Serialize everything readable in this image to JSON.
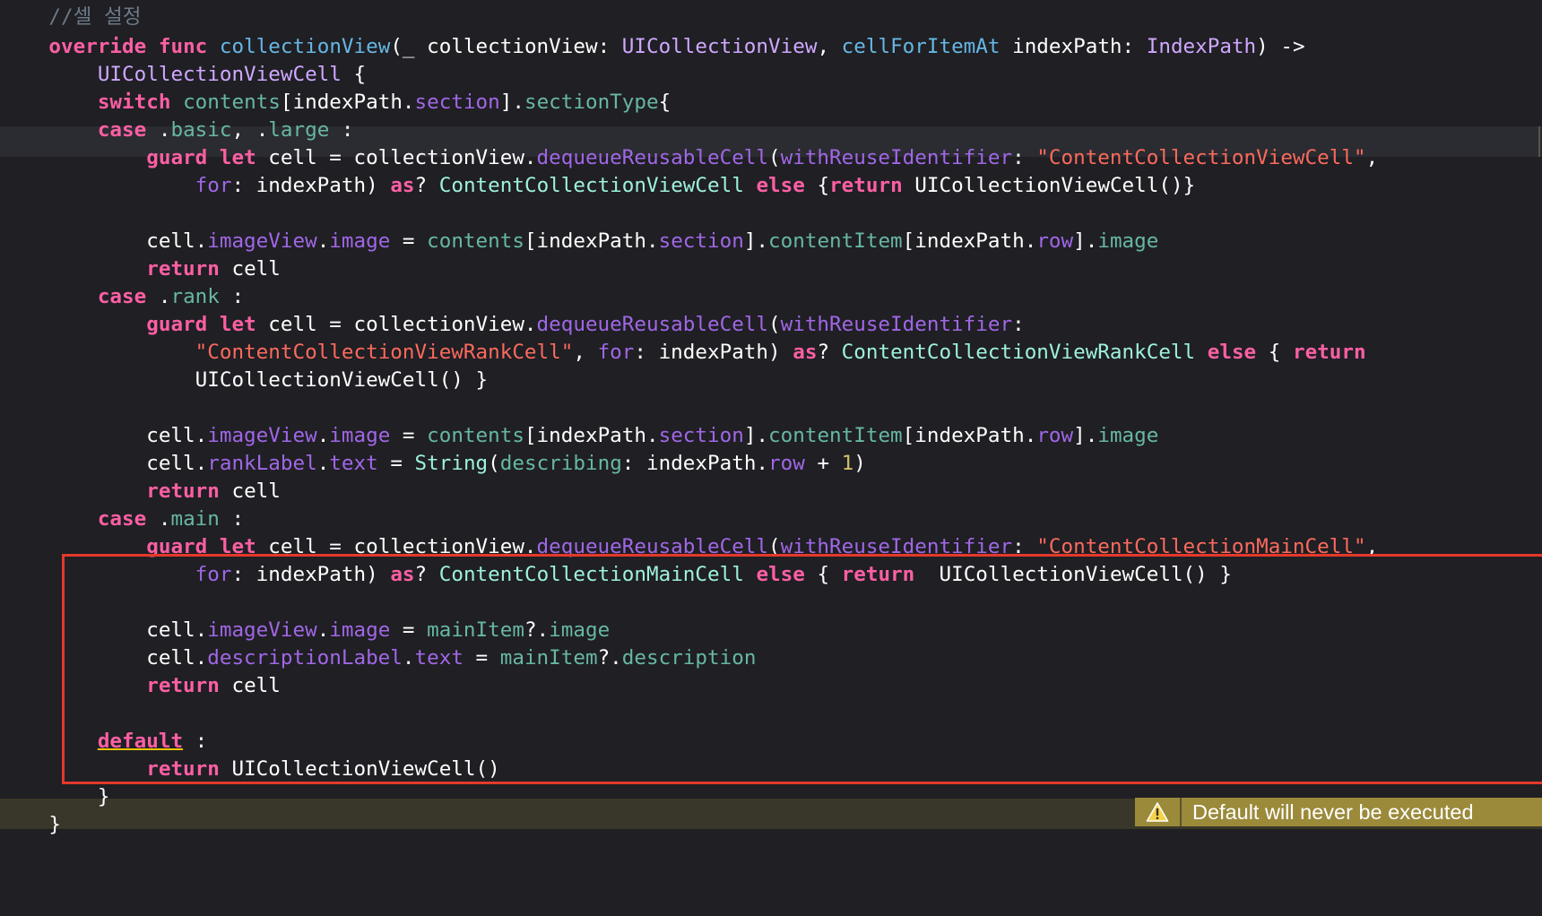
{
  "editor": {
    "lines": [
      [
        {
          "t": "    ",
          "c": "plain"
        },
        {
          "t": "//셀 설정",
          "c": "com"
        }
      ],
      [
        {
          "t": "    ",
          "c": "plain"
        },
        {
          "t": "override",
          "c": "kw"
        },
        {
          "t": " ",
          "c": "plain"
        },
        {
          "t": "func",
          "c": "kw"
        },
        {
          "t": " ",
          "c": "plain"
        },
        {
          "t": "collectionView",
          "c": "fn"
        },
        {
          "t": "(_ collectionView: ",
          "c": "plain"
        },
        {
          "t": "UICollectionView",
          "c": "type"
        },
        {
          "t": ", ",
          "c": "plain"
        },
        {
          "t": "cellForItemAt",
          "c": "fn"
        },
        {
          "t": " indexPath: ",
          "c": "plain"
        },
        {
          "t": "IndexPath",
          "c": "type"
        },
        {
          "t": ") ->",
          "c": "plain"
        }
      ],
      [
        {
          "t": "        ",
          "c": "plain"
        },
        {
          "t": "UICollectionViewCell",
          "c": "type"
        },
        {
          "t": " {",
          "c": "plain"
        }
      ],
      [
        {
          "t": "        ",
          "c": "plain"
        },
        {
          "t": "switch",
          "c": "kw"
        },
        {
          "t": " ",
          "c": "plain"
        },
        {
          "t": "contents",
          "c": "prop"
        },
        {
          "t": "[indexPath.",
          "c": "plain"
        },
        {
          "t": "section",
          "c": "mem"
        },
        {
          "t": "].",
          "c": "plain"
        },
        {
          "t": "sectionType",
          "c": "prop"
        },
        {
          "t": "{",
          "c": "plain"
        }
      ],
      [
        {
          "t": "        ",
          "c": "plain"
        },
        {
          "t": "case",
          "c": "kw"
        },
        {
          "t": " .",
          "c": "plain"
        },
        {
          "t": "basic",
          "c": "prop"
        },
        {
          "t": ", .",
          "c": "plain"
        },
        {
          "t": "large",
          "c": "prop"
        },
        {
          "t": " :",
          "c": "plain"
        }
      ],
      [
        {
          "t": "            ",
          "c": "plain"
        },
        {
          "t": "guard",
          "c": "kw"
        },
        {
          "t": " ",
          "c": "plain"
        },
        {
          "t": "let",
          "c": "kw"
        },
        {
          "t": " cell = collectionView.",
          "c": "plain"
        },
        {
          "t": "dequeueReusableCell",
          "c": "mem"
        },
        {
          "t": "(",
          "c": "plain"
        },
        {
          "t": "withReuseIdentifier",
          "c": "mem"
        },
        {
          "t": ": ",
          "c": "plain"
        },
        {
          "t": "\"ContentCollectionViewCell\"",
          "c": "str"
        },
        {
          "t": ",",
          "c": "plain"
        }
      ],
      [
        {
          "t": "                ",
          "c": "plain"
        },
        {
          "t": "for",
          "c": "mem"
        },
        {
          "t": ": indexPath) ",
          "c": "plain"
        },
        {
          "t": "as",
          "c": "kw"
        },
        {
          "t": "? ",
          "c": "plain"
        },
        {
          "t": "ContentCollectionViewCell",
          "c": "cls"
        },
        {
          "t": " ",
          "c": "plain"
        },
        {
          "t": "else",
          "c": "kw"
        },
        {
          "t": " {",
          "c": "plain"
        },
        {
          "t": "return",
          "c": "kw"
        },
        {
          "t": " UICollectionViewCell()}",
          "c": "plain"
        }
      ],
      [
        {
          "t": "",
          "c": "plain"
        }
      ],
      [
        {
          "t": "            cell.",
          "c": "plain"
        },
        {
          "t": "imageView",
          "c": "mem"
        },
        {
          "t": ".",
          "c": "plain"
        },
        {
          "t": "image",
          "c": "mem"
        },
        {
          "t": " = ",
          "c": "plain"
        },
        {
          "t": "contents",
          "c": "prop"
        },
        {
          "t": "[indexPath.",
          "c": "plain"
        },
        {
          "t": "section",
          "c": "mem"
        },
        {
          "t": "].",
          "c": "plain"
        },
        {
          "t": "contentItem",
          "c": "prop"
        },
        {
          "t": "[indexPath.",
          "c": "plain"
        },
        {
          "t": "row",
          "c": "mem"
        },
        {
          "t": "].",
          "c": "plain"
        },
        {
          "t": "image",
          "c": "prop"
        }
      ],
      [
        {
          "t": "            ",
          "c": "plain"
        },
        {
          "t": "return",
          "c": "kw"
        },
        {
          "t": " cell",
          "c": "plain"
        }
      ],
      [
        {
          "t": "        ",
          "c": "plain"
        },
        {
          "t": "case",
          "c": "kw"
        },
        {
          "t": " .",
          "c": "plain"
        },
        {
          "t": "rank",
          "c": "prop"
        },
        {
          "t": " :",
          "c": "plain"
        }
      ],
      [
        {
          "t": "            ",
          "c": "plain"
        },
        {
          "t": "guard",
          "c": "kw"
        },
        {
          "t": " ",
          "c": "plain"
        },
        {
          "t": "let",
          "c": "kw"
        },
        {
          "t": " cell = collectionView.",
          "c": "plain"
        },
        {
          "t": "dequeueReusableCell",
          "c": "mem"
        },
        {
          "t": "(",
          "c": "plain"
        },
        {
          "t": "withReuseIdentifier",
          "c": "mem"
        },
        {
          "t": ":",
          "c": "plain"
        }
      ],
      [
        {
          "t": "                ",
          "c": "plain"
        },
        {
          "t": "\"ContentCollectionViewRankCell\"",
          "c": "str"
        },
        {
          "t": ", ",
          "c": "plain"
        },
        {
          "t": "for",
          "c": "mem"
        },
        {
          "t": ": indexPath) ",
          "c": "plain"
        },
        {
          "t": "as",
          "c": "kw"
        },
        {
          "t": "? ",
          "c": "plain"
        },
        {
          "t": "ContentCollectionViewRankCell",
          "c": "cls"
        },
        {
          "t": " ",
          "c": "plain"
        },
        {
          "t": "else",
          "c": "kw"
        },
        {
          "t": " { ",
          "c": "plain"
        },
        {
          "t": "return",
          "c": "kw"
        }
      ],
      [
        {
          "t": "                UICollectionViewCell() }",
          "c": "plain"
        }
      ],
      [
        {
          "t": "",
          "c": "plain"
        }
      ],
      [
        {
          "t": "            cell.",
          "c": "plain"
        },
        {
          "t": "imageView",
          "c": "mem"
        },
        {
          "t": ".",
          "c": "plain"
        },
        {
          "t": "image",
          "c": "mem"
        },
        {
          "t": " = ",
          "c": "plain"
        },
        {
          "t": "contents",
          "c": "prop"
        },
        {
          "t": "[indexPath.",
          "c": "plain"
        },
        {
          "t": "section",
          "c": "mem"
        },
        {
          "t": "].",
          "c": "plain"
        },
        {
          "t": "contentItem",
          "c": "prop"
        },
        {
          "t": "[indexPath.",
          "c": "plain"
        },
        {
          "t": "row",
          "c": "mem"
        },
        {
          "t": "].",
          "c": "plain"
        },
        {
          "t": "image",
          "c": "prop"
        }
      ],
      [
        {
          "t": "            cell.",
          "c": "plain"
        },
        {
          "t": "rankLabel",
          "c": "mem"
        },
        {
          "t": ".",
          "c": "plain"
        },
        {
          "t": "text",
          "c": "mem"
        },
        {
          "t": " = ",
          "c": "plain"
        },
        {
          "t": "String",
          "c": "cls"
        },
        {
          "t": "(",
          "c": "plain"
        },
        {
          "t": "describing",
          "c": "prop"
        },
        {
          "t": ": indexPath.",
          "c": "plain"
        },
        {
          "t": "row",
          "c": "mem"
        },
        {
          "t": " + ",
          "c": "plain"
        },
        {
          "t": "1",
          "c": "num"
        },
        {
          "t": ")",
          "c": "plain"
        }
      ],
      [
        {
          "t": "            ",
          "c": "plain"
        },
        {
          "t": "return",
          "c": "kw"
        },
        {
          "t": " cell",
          "c": "plain"
        }
      ],
      [
        {
          "t": "        ",
          "c": "plain"
        },
        {
          "t": "case",
          "c": "kw"
        },
        {
          "t": " .",
          "c": "plain"
        },
        {
          "t": "main",
          "c": "prop"
        },
        {
          "t": " :",
          "c": "plain"
        }
      ],
      [
        {
          "t": "            ",
          "c": "plain"
        },
        {
          "t": "guard",
          "c": "kw"
        },
        {
          "t": " ",
          "c": "plain"
        },
        {
          "t": "let",
          "c": "kw"
        },
        {
          "t": " cell = collectionView.",
          "c": "plain"
        },
        {
          "t": "dequeueReusableCell",
          "c": "mem"
        },
        {
          "t": "(",
          "c": "plain"
        },
        {
          "t": "withReuseIdentifier",
          "c": "mem"
        },
        {
          "t": ": ",
          "c": "plain"
        },
        {
          "t": "\"ContentCollectionMainCell\"",
          "c": "str"
        },
        {
          "t": ",",
          "c": "plain"
        }
      ],
      [
        {
          "t": "                ",
          "c": "plain"
        },
        {
          "t": "for",
          "c": "mem"
        },
        {
          "t": ": indexPath) ",
          "c": "plain"
        },
        {
          "t": "as",
          "c": "kw"
        },
        {
          "t": "? ",
          "c": "plain"
        },
        {
          "t": "ContentCollectionMainCell",
          "c": "cls"
        },
        {
          "t": " ",
          "c": "plain"
        },
        {
          "t": "else",
          "c": "kw"
        },
        {
          "t": " { ",
          "c": "plain"
        },
        {
          "t": "return",
          "c": "kw"
        },
        {
          "t": "  UICollectionViewCell() }",
          "c": "plain"
        }
      ],
      [
        {
          "t": "",
          "c": "plain"
        }
      ],
      [
        {
          "t": "            cell.",
          "c": "plain"
        },
        {
          "t": "imageView",
          "c": "mem"
        },
        {
          "t": ".",
          "c": "plain"
        },
        {
          "t": "image",
          "c": "mem"
        },
        {
          "t": " = ",
          "c": "plain"
        },
        {
          "t": "mainItem",
          "c": "prop"
        },
        {
          "t": "?.",
          "c": "plain"
        },
        {
          "t": "image",
          "c": "prop"
        }
      ],
      [
        {
          "t": "            cell.",
          "c": "plain"
        },
        {
          "t": "descriptionLabel",
          "c": "mem"
        },
        {
          "t": ".",
          "c": "plain"
        },
        {
          "t": "text",
          "c": "mem"
        },
        {
          "t": " = ",
          "c": "plain"
        },
        {
          "t": "mainItem",
          "c": "prop"
        },
        {
          "t": "?.",
          "c": "plain"
        },
        {
          "t": "description",
          "c": "prop"
        }
      ],
      [
        {
          "t": "            ",
          "c": "plain"
        },
        {
          "t": "return",
          "c": "kw"
        },
        {
          "t": " cell",
          "c": "plain"
        }
      ],
      [
        {
          "t": "",
          "c": "plain"
        }
      ],
      [
        {
          "t": "        ",
          "c": "plain"
        },
        {
          "t": "default",
          "c": "kw",
          "u": true
        },
        {
          "t": " :",
          "c": "plain"
        }
      ],
      [
        {
          "t": "            ",
          "c": "plain"
        },
        {
          "t": "return",
          "c": "kw"
        },
        {
          "t": " UICollectionViewCell()",
          "c": "plain"
        }
      ],
      [
        {
          "t": "        }",
          "c": "plain"
        }
      ],
      [
        {
          "t": "    }",
          "c": "plain"
        }
      ]
    ]
  },
  "warning": {
    "icon": "warning-triangle-icon",
    "message": "Default will never be executed"
  },
  "colors": {
    "background": "#1f1f24",
    "keyword": "#fc5fa3",
    "string": "#fc6a5d",
    "comment": "#6c7986",
    "highlight_box": "#e4392b",
    "warning_badge": "#9b8a3a"
  }
}
